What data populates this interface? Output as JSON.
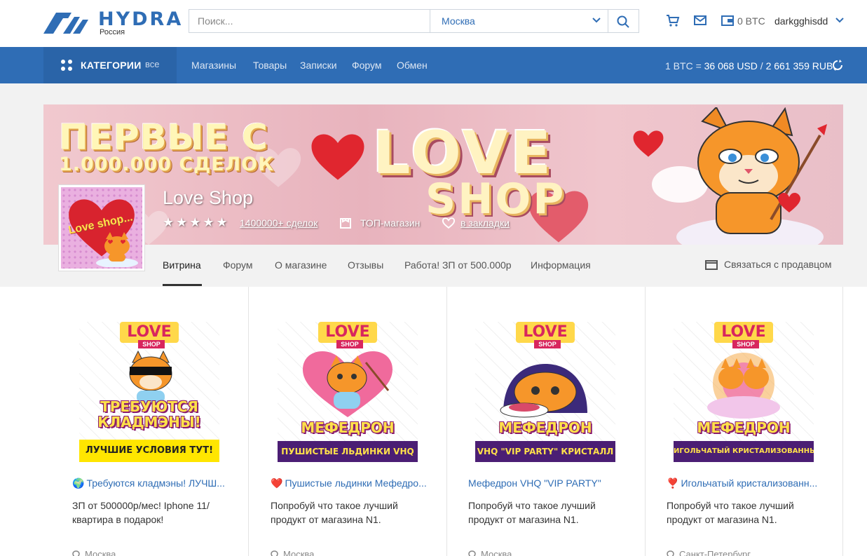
{
  "header": {
    "logo_text": "HYDRA",
    "logo_sub": "Россия",
    "search_placeholder": "Поиск...",
    "city": "Москва",
    "balance": "0 BTC",
    "username": "darkgghisdd",
    "icons": [
      "cart-icon",
      "mail-icon",
      "wallet-icon"
    ]
  },
  "nav": {
    "categories_label": "КАТЕГОРИИ",
    "categories_all": "все",
    "links": [
      "Магазины",
      "Товары",
      "Записки",
      "Форум",
      "Обмен"
    ],
    "rate_prefix": "1 BTC = ",
    "rate_usd": "36 068 USD",
    "rate_sep": " / ",
    "rate_rub": "2 661 359 RUB"
  },
  "shop": {
    "banner_line1": "ПЕРВЫЕ С",
    "banner_line2": "1.000.000 СДЕЛОК",
    "banner_love": "LOVE",
    "banner_shop": "SHOP",
    "avatar_text": "Love shop...",
    "name": "Love Shop",
    "stars": "★★★★★",
    "rating": 5,
    "deals": "1400000+ сделок",
    "top_label": "ТОП-магазин",
    "bookmark_label": "в закладки"
  },
  "tabs": {
    "items": [
      "Витрина",
      "Форум",
      "О магазине",
      "Отзывы",
      "Работа! ЗП от 500.000р",
      "Информация"
    ],
    "active": "Витрина",
    "contact": "Связаться с продавцом"
  },
  "products": [
    {
      "img_caption": "ТРЕБУЮТСЯ КЛАДМЭНЫ!",
      "img_sub": "ЛУЧШИЕ УСЛОВИЯ ТУТ!",
      "title_tag": "🌍",
      "title": "Требуются кладмэны! ЛУЧШ...",
      "desc": "ЗП от 500000р/мес! Iphone 11/ квартира в подарок!",
      "location": "Москва"
    },
    {
      "img_caption": "МЕФЕДРОН",
      "img_sub": "ПУШИСТЫЕ ЛЬДИНКИ VHQ",
      "title_tag": "❤️",
      "title": "Пушистые льдинки Мефедро...",
      "desc": "Попробуй что такое лучший продукт от магазина N1.",
      "location": "Москва"
    },
    {
      "img_caption": "МЕФЕДРОН",
      "img_sub": "VHQ \"VIP PARTY\" КРИСТАЛЛ",
      "title_tag": "",
      "title": "Мефедрон VHQ \"VIP PARTY\"",
      "desc": "Попробуй что такое лучший продукт от магазина N1.",
      "location": "Москва"
    },
    {
      "img_caption": "МЕФЕДРОН",
      "img_sub": "ИГОЛЬЧАТЫЙ КРИСТАЛИЗОВАННЫЙ",
      "title_tag": "❣️",
      "title": "Игольчатый кристализованн...",
      "desc": "Попробуй что такое лучший продукт от магазина N1.",
      "location": "Санкт-Петербург"
    }
  ],
  "colors": {
    "brand_blue": "#2f6db5",
    "nav_bg": "#2f6db5",
    "banner_pink": "#e8b3bd"
  }
}
